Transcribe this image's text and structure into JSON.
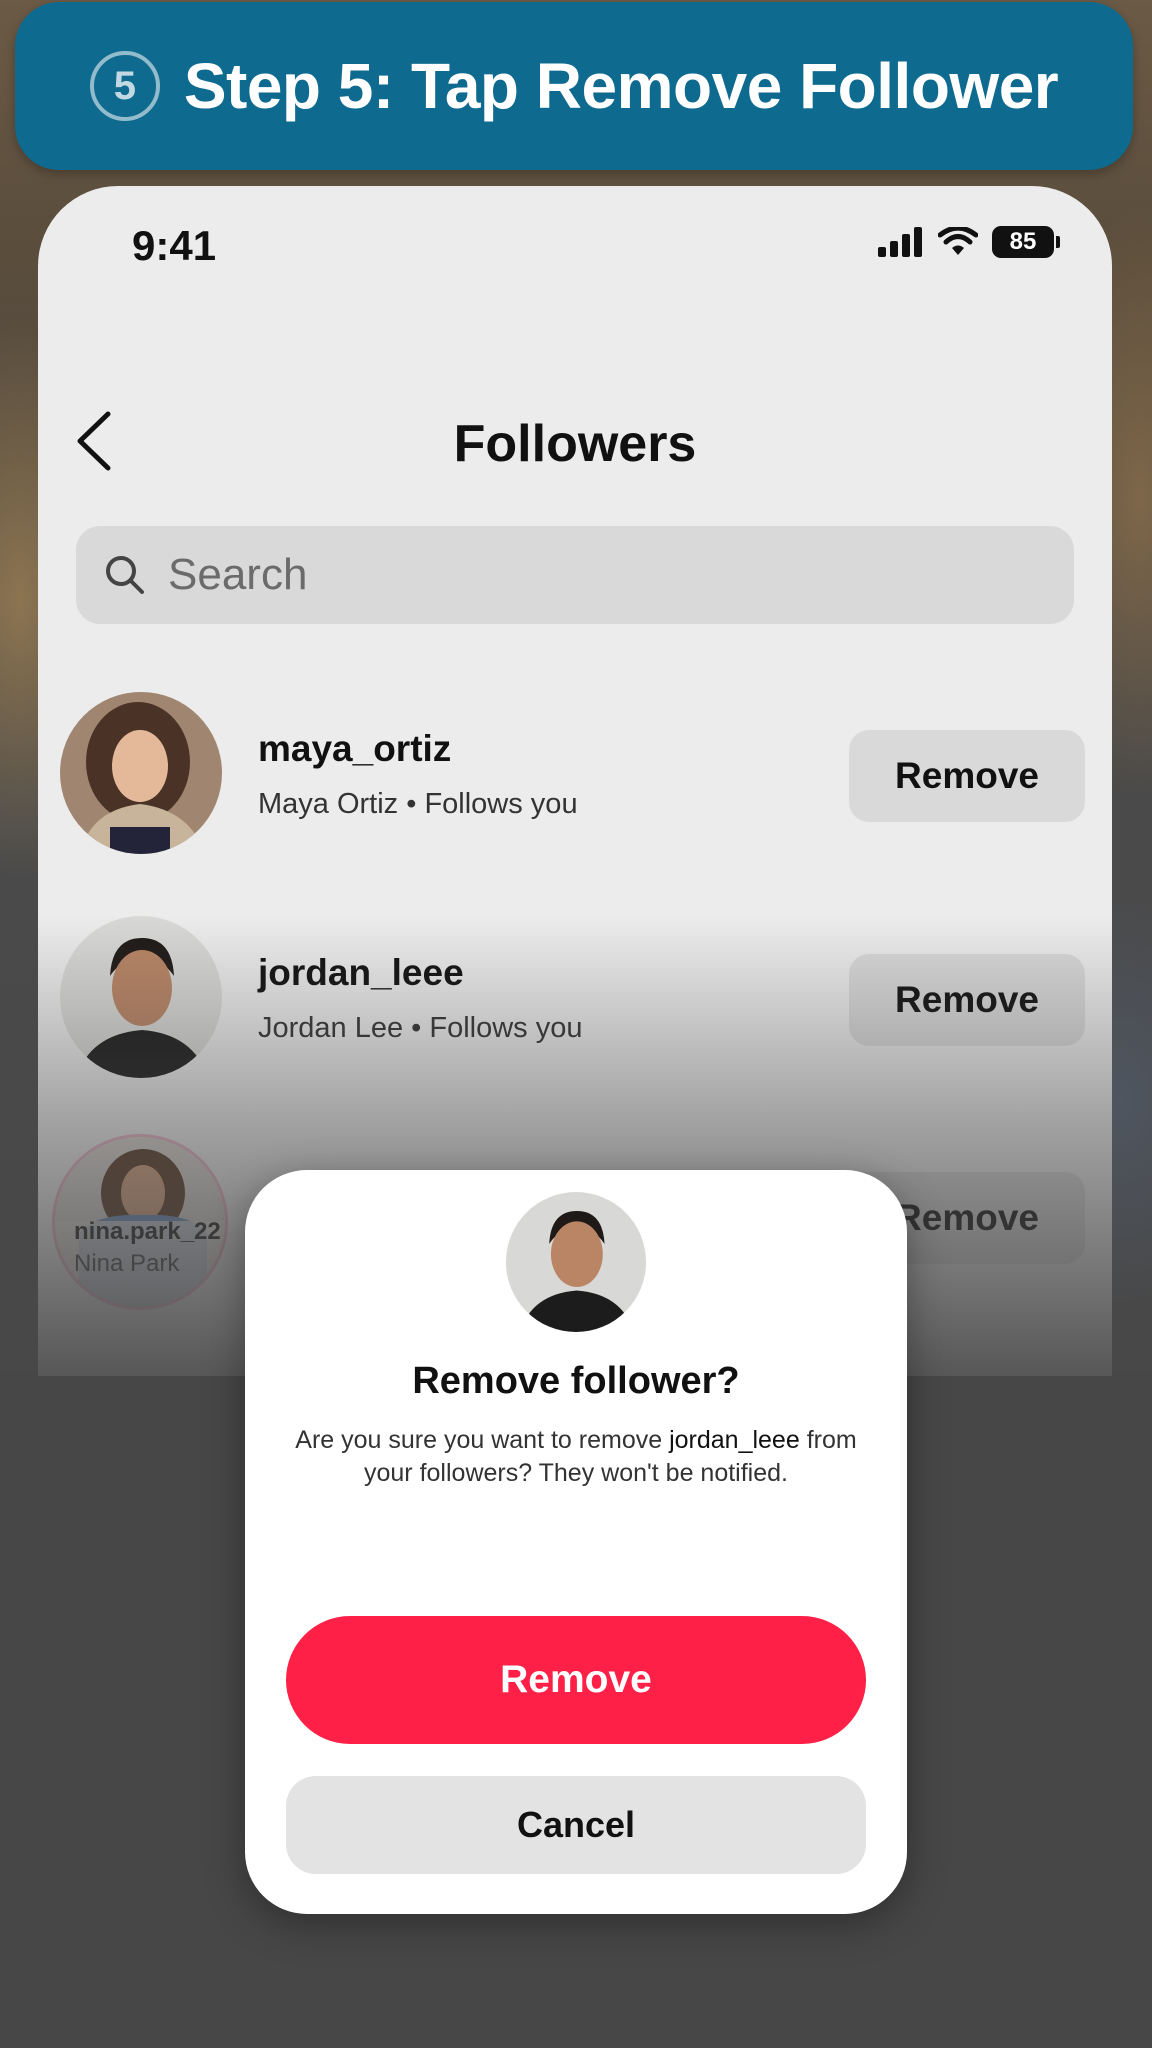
{
  "banner": {
    "step_number": "5",
    "title": "Step 5: Tap Remove Follower"
  },
  "status_bar": {
    "time": "9:41",
    "battery": "85"
  },
  "header": {
    "title": "Followers"
  },
  "search": {
    "placeholder": "Search"
  },
  "followers": [
    {
      "username": "maya_ortiz",
      "subtitle": "Maya Ortiz • Follows you",
      "button": "Remove"
    },
    {
      "username": "jordan_leee",
      "subtitle": "Jordan Lee • Follows you",
      "button": "Remove"
    },
    {
      "username": "nina.park_22",
      "subtitle": "Nina Park",
      "button": "Remove"
    }
  ],
  "dialog": {
    "title": "Remove follower?",
    "message_before": "Are you sure you want to remove ",
    "message_user": "jordan_leee",
    "message_after": " from your followers? They won't be notified.",
    "confirm_label": "Remove",
    "cancel_label": "Cancel"
  },
  "colors": {
    "banner": "#0e6a8e",
    "destructive": "#ff2048"
  }
}
